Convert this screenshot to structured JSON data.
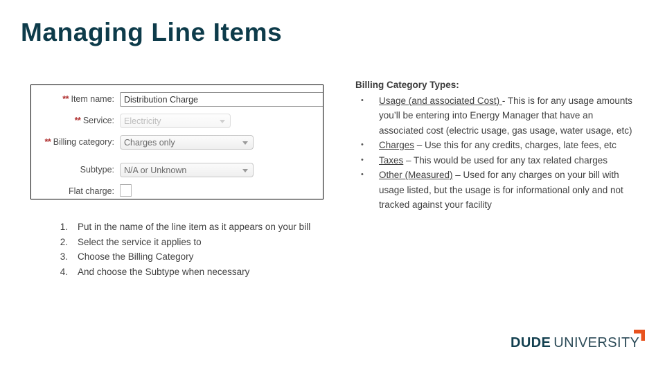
{
  "slide": {
    "title": "Managing Line Items",
    "title_color": "#0d3b4a"
  },
  "form": {
    "rows": [
      {
        "label": "Item name:",
        "required_marker": "**",
        "control": "text-input",
        "value": "Distribution Charge"
      },
      {
        "label": "Service:",
        "required_marker": "**",
        "control": "select-disabled",
        "value": "Electricity"
      },
      {
        "label": "Billing category:",
        "required_marker": "**",
        "control": "select",
        "value": "Charges only"
      },
      {
        "label": "Subtype:",
        "required_marker": "",
        "control": "select",
        "value": "N/A or Unknown"
      },
      {
        "label": "Flat charge:",
        "required_marker": "",
        "control": "checkbox",
        "value": ""
      }
    ]
  },
  "steps": [
    {
      "number": "1.",
      "text": "Put in the name of the line item as it appears on your bill"
    },
    {
      "number": "2.",
      "text": "Select the service it applies to"
    },
    {
      "number": "3.",
      "text": "Choose the Billing Category"
    },
    {
      "number": "4.",
      "text": "And choose the Subtype when necessary"
    }
  ],
  "billing_types": {
    "heading": "Billing Category Types:",
    "bullet": "•",
    "items": [
      {
        "term": "Usage (and associated Cost) ",
        "description": "- This is for any usage amounts you’ll be entering into Energy Manager that have an associated cost (electric usage, gas usage, water usage, etc)"
      },
      {
        "term": "Charges",
        "description": " – Use this for any credits, charges, late fees, etc"
      },
      {
        "term": "Taxes",
        "description": " – This would be used for any tax related charges"
      },
      {
        "term": "Other (Measured)",
        "description": " – Used for any charges on your bill with usage listed, but the usage is for informational only and not tracked against your facility"
      }
    ]
  },
  "logo": {
    "primary": "DUDE",
    "secondary": "UNIVERSITY",
    "mark_color": "#e8521e",
    "primary_color": "#123f4f"
  }
}
